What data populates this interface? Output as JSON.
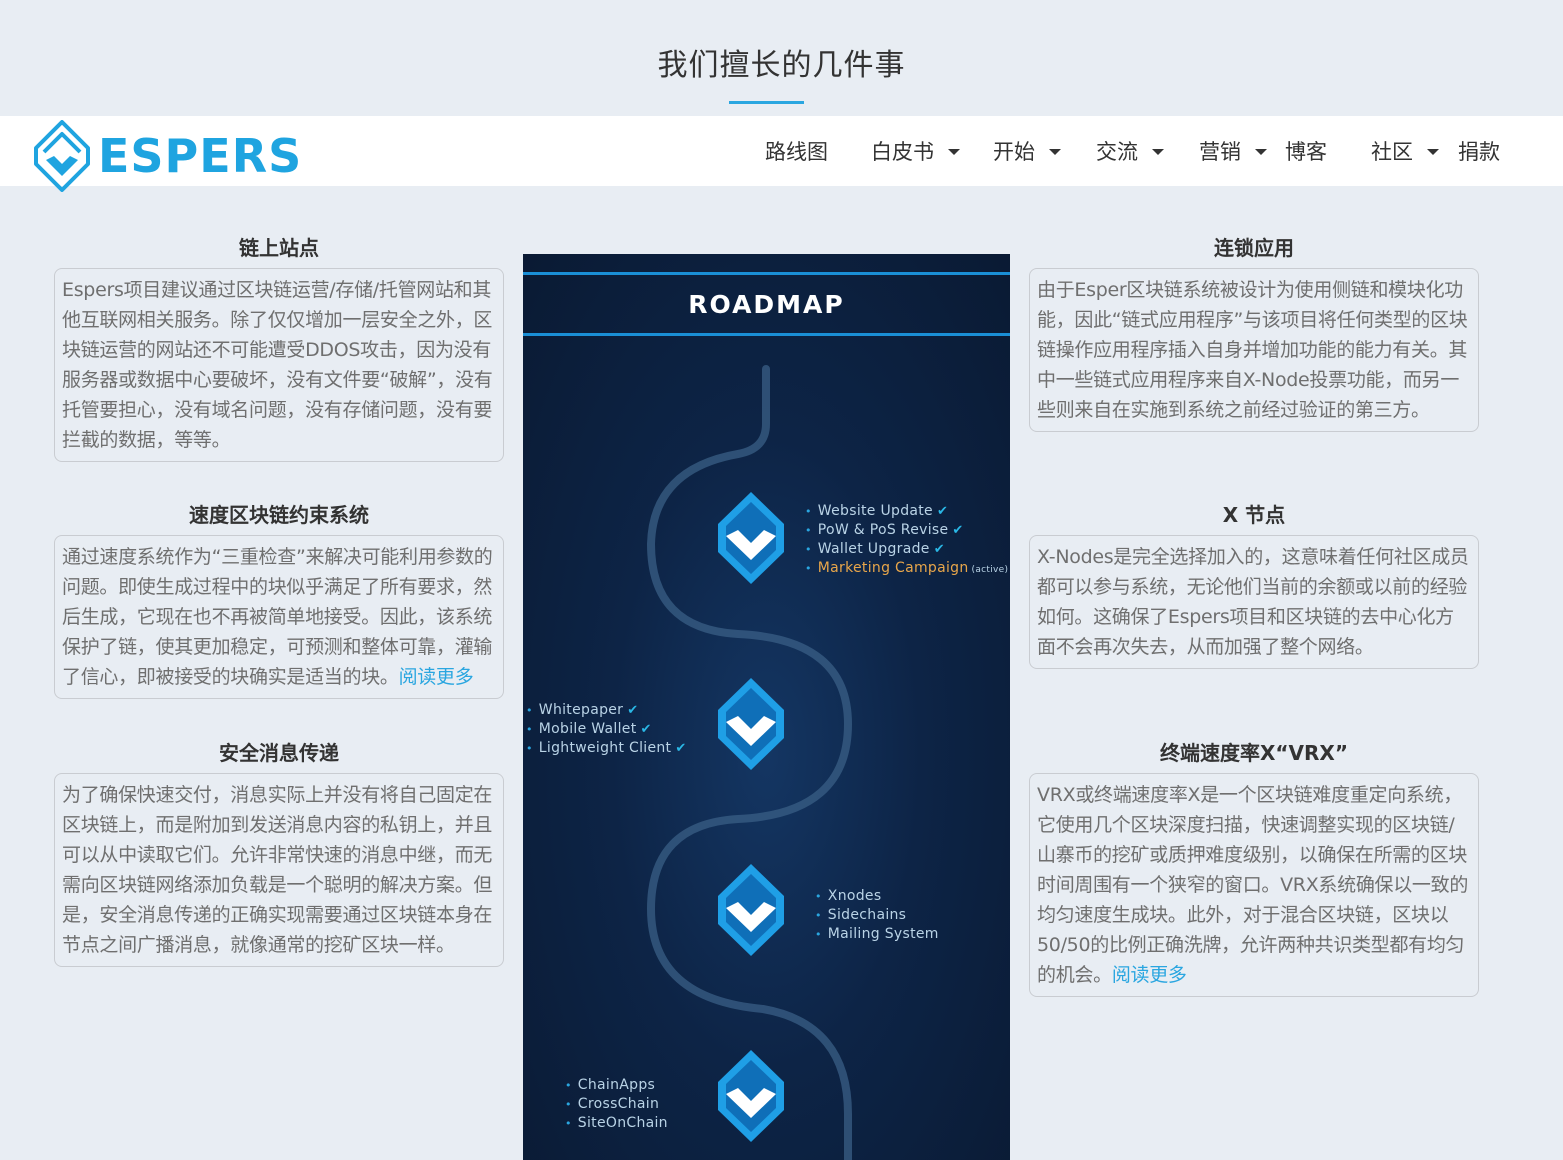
{
  "page": {
    "section_title": "我们擅长的几件事"
  },
  "navbar": {
    "logo_text": "ESPERS",
    "items": [
      {
        "label": "路线图",
        "dropdown": false
      },
      {
        "label": "白皮书",
        "dropdown": true
      },
      {
        "label": "开始",
        "dropdown": true
      },
      {
        "label": "交流",
        "dropdown": true
      },
      {
        "label": "营销",
        "dropdown": true
      },
      {
        "label": "博客",
        "dropdown": false
      },
      {
        "label": "社区",
        "dropdown": true
      },
      {
        "label": "捐款",
        "dropdown": false
      }
    ]
  },
  "features_left": [
    {
      "title": "链上站点",
      "body": "Espers项目建议通过区块链运营/存储/托管网站和其他互联网相关服务。除了仅仅增加一层安全之外，区块链运营的网站还不可能遭受DDOS攻击，因为没有服务器或数据中心要破坏，没有文件要“破解”，没有托管要担心，没有域名问题，没有存储问题，没有要拦截的数据，等等。",
      "read_more": ""
    },
    {
      "title": "速度区块链约束系统",
      "body": "通过速度系统作为“三重检查”来解决可能利用参数的问题。即使生成过程中的块似乎满足了所有要求，然后生成，它现在也不再被简单地接受。因此，该系统保护了链，使其更加稳定，可预测和整体可靠，灌输了信心，即被接受的块确实是适当的块。",
      "read_more": "阅读更多"
    },
    {
      "title": "安全消息传递",
      "body": "为了确保快速交付，消息实际上并没有将自己固定在区块链上，而是附加到发送消息内容的私钥上，并且可以从中读取它们。允许非常快速的消息中继，而无需向区块链网络添加负载是一个聪明的解决方案。但是，安全消息传递的正确实现需要通过区块链本身在节点之间广播消息，就像通常的挖矿区块一样。",
      "read_more": ""
    }
  ],
  "features_right": [
    {
      "title": "连锁应用",
      "body": "由于Esper区块链系统被设计为使用侧链和模块化功能，因此“链式应用程序”与该项目将任何类型的区块链操作应用程序插入自身并增加功能的能力有关。其中一些链式应用程序来自X-Node投票功能，而另一些则来自在实施到系统之前经过验证的第三方。",
      "read_more": ""
    },
    {
      "title": "X 节点",
      "body": "X-Nodes是完全选择加入的，这意味着任何社区成员都可以参与系统，无论他们当前的余额或以前的经验如何。这确保了Espers项目和区块链的去中心化方面不会再次失去，从而加强了整个网络。",
      "read_more": ""
    },
    {
      "title": "终端速度率X“VRX”",
      "body": "VRX或终端速度率X是一个区块链难度重定向系统，它使用几个区块深度扫描，快速调整实现的区块链/山寨币的挖矿或质押难度级别，以确保在所需的区块时间周围有一个狭窄的窗口。VRX系统确保以一致的均匀速度生成块。此外，对于混合区块链，区块以50/50的比例正确洗牌，允许两种共识类型都有均匀的机会。",
      "read_more": "阅读更多"
    }
  ],
  "roadmap": {
    "title": "ROADMAP",
    "milestones": [
      {
        "items": [
          {
            "text": "Website Update",
            "done": true
          },
          {
            "text": "PoW & PoS Revise",
            "done": true
          },
          {
            "text": "Wallet Upgrade",
            "done": true
          },
          {
            "text": "Marketing Campaign",
            "done": false,
            "note": "(active)"
          }
        ]
      },
      {
        "items": [
          {
            "text": "Whitepaper",
            "done": true
          },
          {
            "text": "Mobile Wallet",
            "done": true
          },
          {
            "text": "Lightweight Client",
            "done": true
          }
        ]
      },
      {
        "items": [
          {
            "text": "Xnodes",
            "done": false
          },
          {
            "text": "Sidechains",
            "done": false
          },
          {
            "text": "Mailing System",
            "done": false
          }
        ]
      },
      {
        "items": [
          {
            "text": "ChainApps",
            "done": false
          },
          {
            "text": "CrossChain",
            "done": false
          },
          {
            "text": "SiteOnChain",
            "done": false
          }
        ]
      }
    ]
  },
  "colors": {
    "accent": "#2aa6e0",
    "logo": "#1fa4e0",
    "roadmap_bg": "#0d2446",
    "page_bg": "#e8edf3"
  },
  "icons": [
    "espers-logo-icon",
    "caret-down-icon",
    "roadmap-node-icon",
    "check-icon"
  ]
}
